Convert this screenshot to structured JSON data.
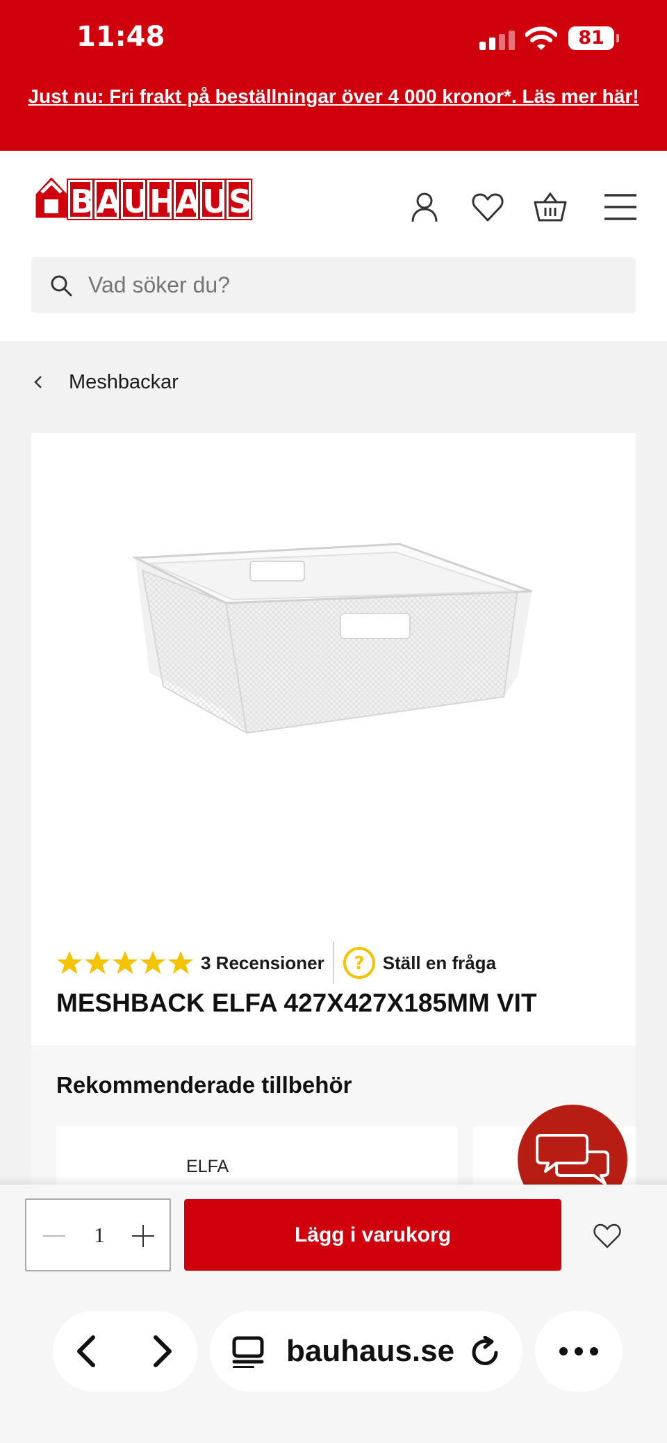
{
  "status_bar": {
    "time": "11:48",
    "battery": "81"
  },
  "promo": {
    "text": "Just nu: Fri frakt på beställningar över 4 000 kronor*. Läs mer här!"
  },
  "header": {
    "logo_letters": [
      "B",
      "A",
      "U",
      "H",
      "A",
      "U",
      "S"
    ],
    "icons": [
      "account-icon",
      "heart-icon",
      "basket-icon",
      "menu-icon"
    ]
  },
  "search": {
    "placeholder": "Vad söker du?"
  },
  "breadcrumb": {
    "label": "Meshbackar"
  },
  "product": {
    "rating": 5,
    "rating_max": 5,
    "reviews_label": "3 Recensioner",
    "ask_label": "Ställ en fråga",
    "title": "MESHBACK ELFA 427X427X185MM VIT"
  },
  "recommended": {
    "title": "Rekommenderade tillbehör",
    "first_brand": "ELFA"
  },
  "cart_bar": {
    "quantity": "1",
    "add_label": "Lägg i varukorg"
  },
  "browser": {
    "url": "bauhaus.se"
  },
  "colors": {
    "brand_red": "#d0000c",
    "star_yellow": "#f5c400",
    "chat_red": "#b81d13"
  }
}
